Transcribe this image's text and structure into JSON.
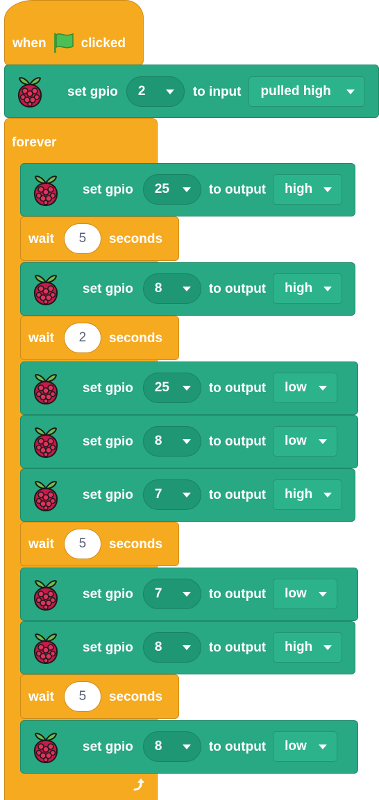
{
  "colors": {
    "events": "#F6AA1F",
    "control": "#F6AA1F",
    "gpio": "#28A883",
    "text": "#ffffff",
    "number_text": "#575E75"
  },
  "hat": {
    "prefix": "when",
    "icon": "green-flag-icon",
    "suffix": "clicked"
  },
  "setup": {
    "icon": "raspberry-pi-icon",
    "label": "set gpio",
    "pin": "2",
    "mid": "to input",
    "mode": "pulled high"
  },
  "forever": {
    "label": "forever",
    "icon": "repeat-arrow-icon"
  },
  "wait_text": {
    "prefix": "wait",
    "suffix": "seconds"
  },
  "gpio_text": {
    "label": "set gpio",
    "mid": "to output"
  },
  "program": [
    {
      "type": "gpio",
      "pin": "25",
      "state": "high"
    },
    {
      "type": "wait",
      "value": "5"
    },
    {
      "type": "gpio",
      "pin": "8",
      "state": "high"
    },
    {
      "type": "wait",
      "value": "2"
    },
    {
      "type": "gpio",
      "pin": "25",
      "state": "low"
    },
    {
      "type": "gpio",
      "pin": "8",
      "state": "low"
    },
    {
      "type": "gpio",
      "pin": "7",
      "state": "high"
    },
    {
      "type": "wait",
      "value": "5"
    },
    {
      "type": "gpio",
      "pin": "7",
      "state": "low"
    },
    {
      "type": "gpio",
      "pin": "8",
      "state": "high"
    },
    {
      "type": "wait",
      "value": "5"
    },
    {
      "type": "gpio",
      "pin": "8",
      "state": "low"
    }
  ]
}
